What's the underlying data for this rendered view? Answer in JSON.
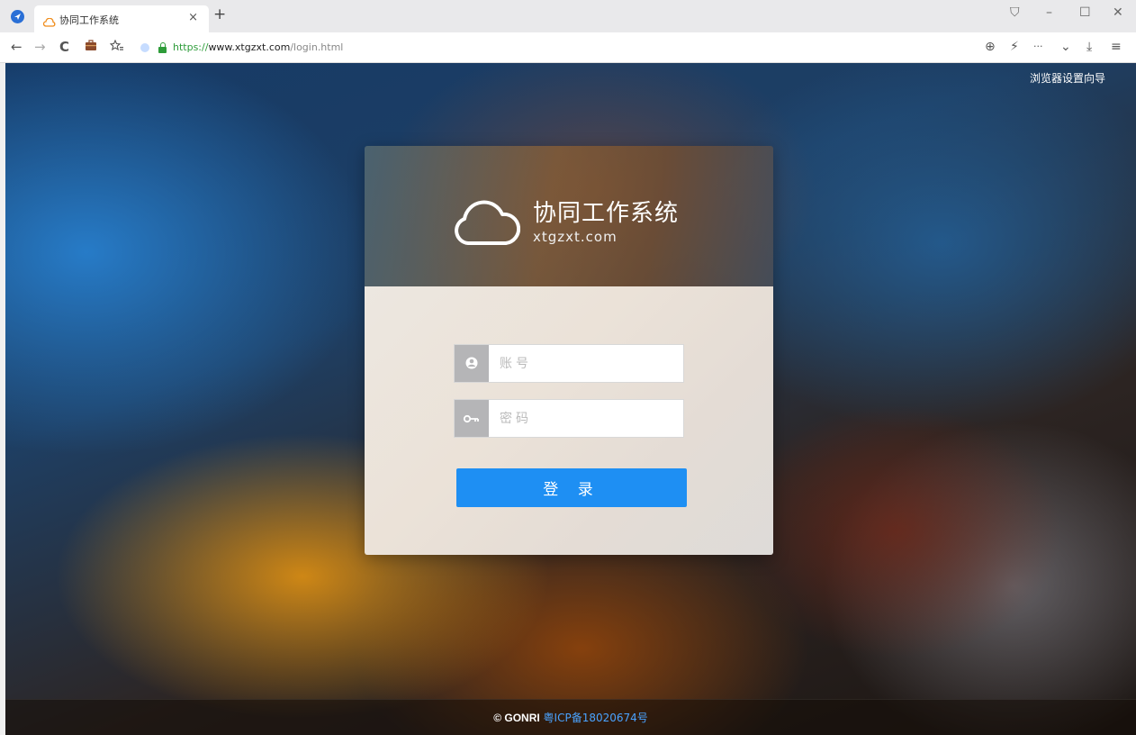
{
  "browser": {
    "tab_title": "协同工作系统",
    "tab_close": "×",
    "new_tab": "+",
    "url_protocol": "https://",
    "url_host": "www.xtgzxt.com",
    "url_path": "/login.html",
    "window_controls": {
      "skin": "⛉",
      "minimize": "–",
      "maximize": "☐",
      "close": "✕"
    },
    "nav": {
      "back": "←",
      "forward": "→",
      "reload": "C"
    },
    "toolbar": {
      "zoom": "⊕",
      "flash": "⚡",
      "more": "···",
      "dropdown": "⌄",
      "download": "⤓",
      "menu": "≡"
    }
  },
  "page": {
    "setup_guide": "浏览器设置向导",
    "brand": {
      "title": "协同工作系统",
      "domain": "xtgzxt.com"
    },
    "login": {
      "account_placeholder": "账号",
      "password_placeholder": "密码",
      "submit_label": "登 录"
    },
    "footer": {
      "copyright": "© GONRI",
      "icp": "粤ICP备18020674号"
    }
  },
  "colors": {
    "accent": "#1e8ff3",
    "secure": "#2e9c3a",
    "link": "#4aa3ff"
  }
}
